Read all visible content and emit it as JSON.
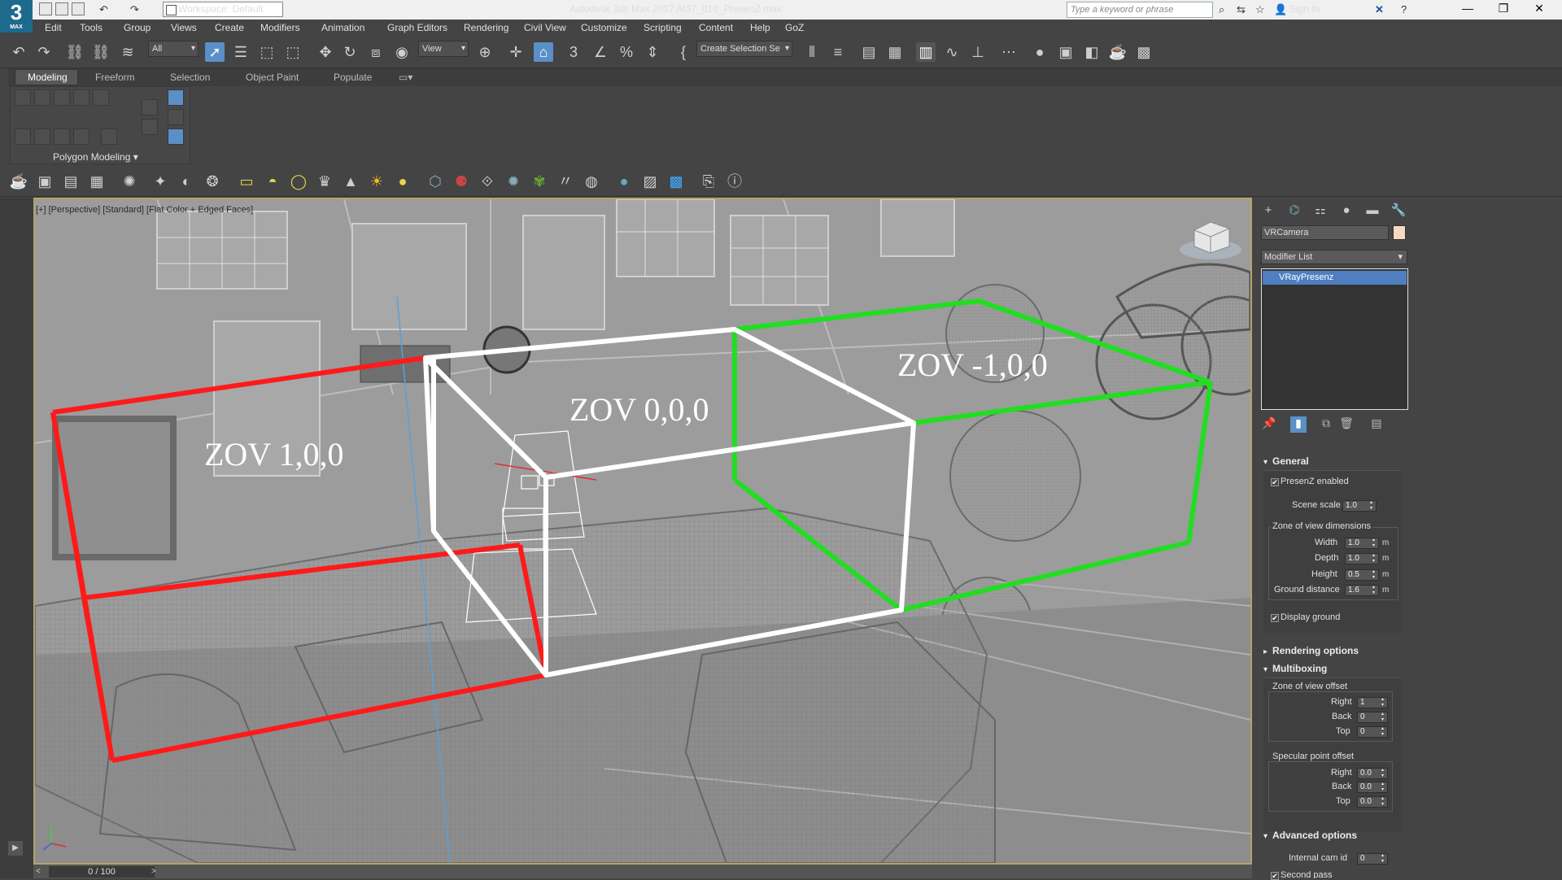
{
  "app": {
    "logo_text": "3",
    "logo_sub": "MAX",
    "workspace": "Workspace: Default",
    "window_title": "Autodesk 3ds Max 2017     AI37_010_PresenZ.max",
    "search_placeholder": "Type a keyword or phrase",
    "sign_in": "Sign In"
  },
  "menu": [
    "Edit",
    "Tools",
    "Group",
    "Views",
    "Create",
    "Modifiers",
    "Animation",
    "Graph Editors",
    "Rendering",
    "Civil View",
    "Customize",
    "Scripting",
    "Content",
    "Help",
    "GoZ"
  ],
  "toolbar": {
    "selection_filter": "All",
    "ref_coord": "View",
    "named_selection": "Create Selection Se"
  },
  "ribbon": {
    "tabs": [
      "Modeling",
      "Freeform",
      "Selection",
      "Object Paint",
      "Populate"
    ],
    "active_tab": "Modeling",
    "panel_label": "Polygon Modeling"
  },
  "viewport": {
    "label": "[+] [Perspective] [Standard] [Flat Color + Edged Faces]",
    "zov_labels": {
      "left": "ZOV  1,0,0",
      "center": "ZOV  0,0,0",
      "right": "ZOV  -1,0,0"
    },
    "box_colors": {
      "left": "#ff1a1a",
      "center": "#ffffff",
      "right": "#22dd22"
    }
  },
  "command_panel": {
    "object_name": "VRCamera",
    "object_color": "#f5d9c3",
    "modifier_list": "Modifier List",
    "stack_item": "VRayPresenz",
    "general": {
      "title": "General",
      "presenz_enabled": "PresenZ enabled",
      "scene_scale_label": "Scene scale",
      "scene_scale": "1.0",
      "zov_dims_title": "Zone of view dimensions",
      "width_label": "Width",
      "width": "1.0",
      "depth_label": "Depth",
      "depth": "1.0",
      "height_label": "Height",
      "height": "0.5",
      "ground_label": "Ground distance",
      "ground": "1.6",
      "unit": "m",
      "display_ground": "Display ground"
    },
    "rendering_options": "Rendering options",
    "multiboxing": {
      "title": "Multiboxing",
      "zov_offset_title": "Zone of view offset",
      "right_label": "Right",
      "right": "1",
      "back_label": "Back",
      "back": "0",
      "top_label": "Top",
      "top": "0",
      "spec_title": "Specular point offset",
      "s_right": "0.0",
      "s_back": "0.0",
      "s_top": "0.0"
    },
    "advanced": {
      "title": "Advanced options",
      "cam_id_label": "Internal cam id",
      "cam_id": "0",
      "second_pass": "Second pass"
    }
  },
  "timeline": {
    "frame": "0 / 100"
  }
}
